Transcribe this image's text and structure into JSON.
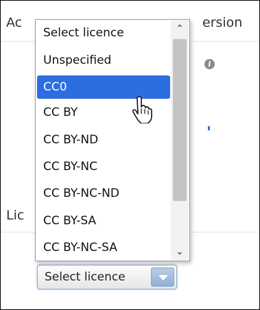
{
  "background": {
    "header_left": "Ac",
    "header_right": "ersion",
    "section_left": "Lic"
  },
  "select": {
    "label": "Select licence"
  },
  "listbox": {
    "header": "Select licence",
    "options": [
      "Unspecified",
      "CC0",
      "CC BY",
      "CC BY-ND",
      "CC BY-NC",
      "CC BY-NC-ND",
      "CC BY-SA",
      "CC BY-NC-SA"
    ],
    "selected": "CC0"
  },
  "icons": {
    "info": "info-icon",
    "scroll_up": "chevron-up-icon",
    "scroll_down": "chevron-down-icon",
    "cursor": "hand-pointer-icon"
  },
  "colors": {
    "selection": "#2c6ee2",
    "select_button": "#9ab6d8"
  }
}
